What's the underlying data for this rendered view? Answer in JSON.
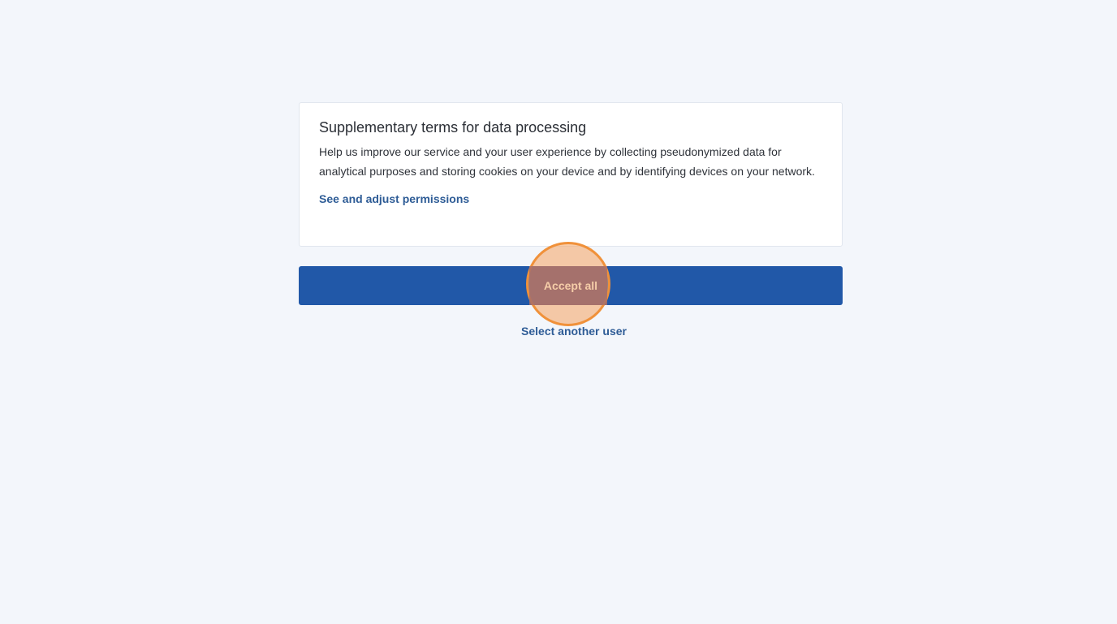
{
  "consent": {
    "title": "Supplementary terms for data processing",
    "description": "Help us improve our service and your user experience by collecting pseudonymized data for analytical purposes and storing cookies on your device and by identifying devices on your network.",
    "adjust_link": "See and adjust permissions"
  },
  "actions": {
    "accept_label": "Accept all",
    "select_user_label": "Select another user"
  },
  "colors": {
    "background": "#f3f6fb",
    "primary_button": "#2158a8",
    "link": "#2e5c96",
    "click_highlight": "#f0913a"
  }
}
